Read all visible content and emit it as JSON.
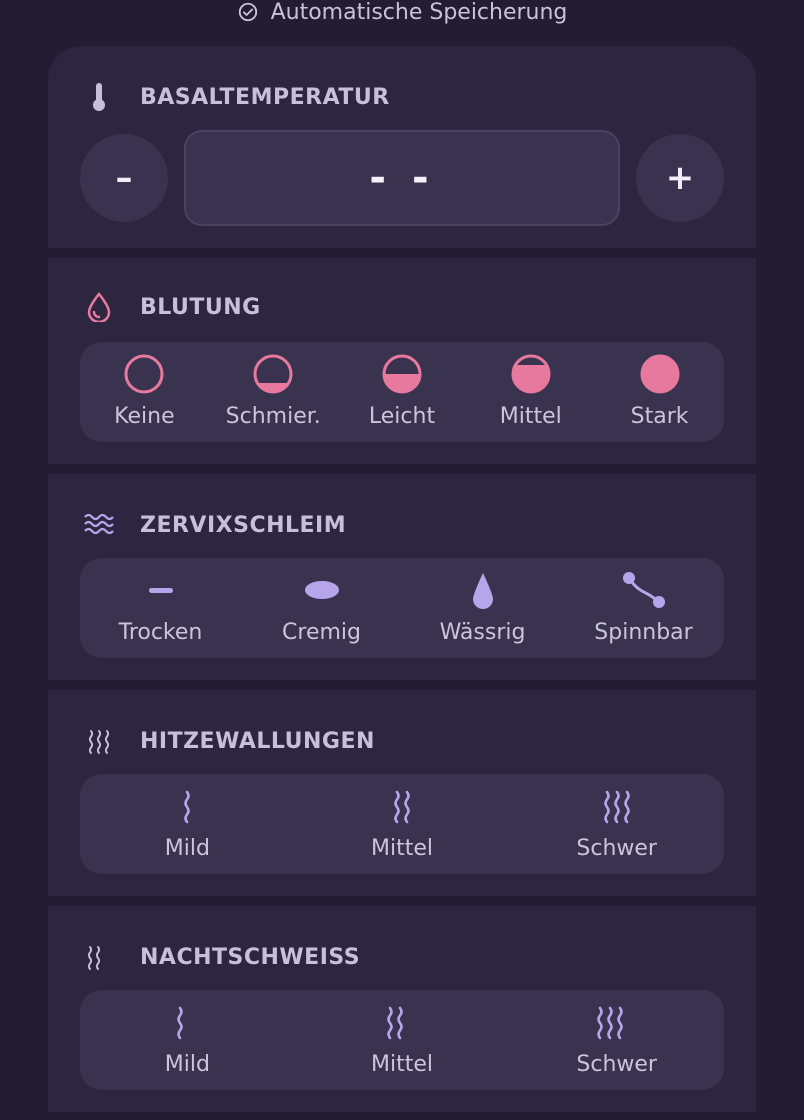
{
  "autosave": {
    "label": "Automatische Speicherung",
    "icon": "check-circle-icon"
  },
  "colors": {
    "pink": "#e8799e",
    "lavender": "#b7a5ec",
    "card": "#2c2640",
    "chip": "#3a3350",
    "bg": "#221d33"
  },
  "temperature": {
    "title": "BASALTEMPERATUR",
    "minus": "–",
    "plus": "+",
    "value": "- -"
  },
  "bleeding": {
    "title": "BLUTUNG",
    "options": [
      {
        "label": "Keine",
        "level": 0
      },
      {
        "label": "Schmier.",
        "level": 0.25
      },
      {
        "label": "Leicht",
        "level": 0.5
      },
      {
        "label": "Mittel",
        "level": 0.75
      },
      {
        "label": "Stark",
        "level": 1
      }
    ]
  },
  "mucus": {
    "title": "ZERVIXSCHLEIM",
    "options": [
      {
        "label": "Trocken",
        "icon": "dash-icon"
      },
      {
        "label": "Cremig",
        "icon": "oval-icon"
      },
      {
        "label": "Wässrig",
        "icon": "drop-icon"
      },
      {
        "label": "Spinnbar",
        "icon": "stretch-icon"
      }
    ]
  },
  "hotflashes": {
    "title": "HITZEWALLUNGEN",
    "options": [
      {
        "label": "Mild",
        "waves": 1
      },
      {
        "label": "Mittel",
        "waves": 2
      },
      {
        "label": "Schwer",
        "waves": 3
      }
    ]
  },
  "nightsweats": {
    "title": "NACHTSCHWEISS",
    "options": [
      {
        "label": "Mild",
        "waves": 1
      },
      {
        "label": "Mittel",
        "waves": 2
      },
      {
        "label": "Schwer",
        "waves": 3
      }
    ]
  }
}
